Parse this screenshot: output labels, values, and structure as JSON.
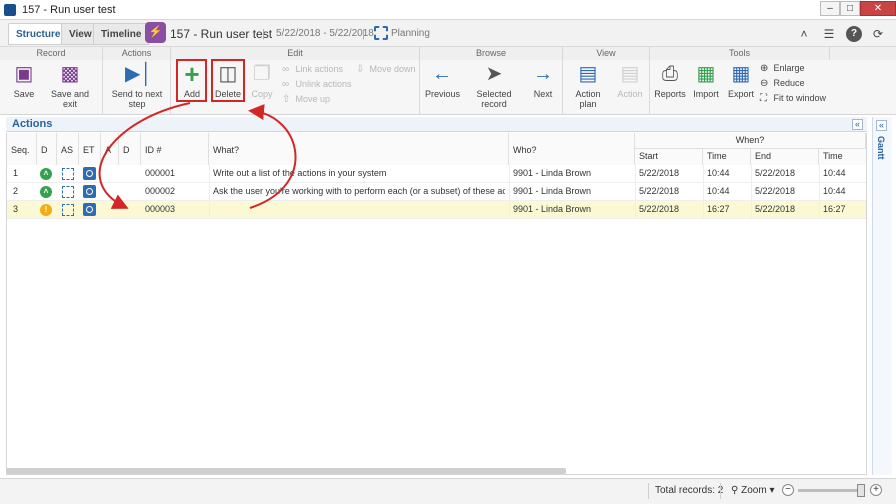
{
  "window": {
    "title": "157 - Run user test",
    "minimize": "–",
    "maximize": "□",
    "close": "✕"
  },
  "tabs": [
    {
      "label": "Structure"
    },
    {
      "label": "View"
    },
    {
      "label": "Timeline"
    }
  ],
  "record": {
    "badge": "⚡",
    "title": "157 - Run user test",
    "separator": "|",
    "dates": "5/22/2018 - 5/22/2018",
    "status": "Planning"
  },
  "topright": {
    "collapse": "˄",
    "list": "☰",
    "help": "?",
    "refresh": "⟳"
  },
  "ribbon": {
    "groups": {
      "record": "Record",
      "actions": "Actions",
      "edit": "Edit",
      "browse": "Browse",
      "view": "View",
      "tools": "Tools"
    },
    "save": "Save",
    "save_exit": "Save and exit",
    "send_next": "Send to next step",
    "add": "Add",
    "delete": "Delete",
    "copy": "Copy",
    "link_actions": "Link actions",
    "unlink_actions": "Unlink actions",
    "move_up": "Move up",
    "move_down": "Move down",
    "previous": "Previous",
    "selected_record": "Selected record",
    "next": "Next",
    "action_plan": "Action plan",
    "action": "Action",
    "reports": "Reports",
    "import": "Import",
    "export": "Export",
    "enlarge": "Enlarge",
    "reduce": "Reduce",
    "fit_window": "Fit to window"
  },
  "section": {
    "title": "Actions",
    "collapse": "«"
  },
  "grid": {
    "headers": {
      "seq": "Seq.",
      "d1": "D",
      "as": "AS",
      "et": "ET",
      "a": "A",
      "d2": "D",
      "id": "ID #",
      "what": "What?",
      "who": "Who?",
      "when": "When?",
      "start": "Start",
      "time1": "Time",
      "end": "End",
      "time2": "Time"
    },
    "rows": [
      {
        "seq": "1",
        "status": "˄",
        "id": "000001",
        "what": "Write out a list of the actions in your system",
        "who": "9901 - Linda Brown",
        "start": "5/22/2018",
        "start_time": "10:44",
        "end": "5/22/2018",
        "end_time": "10:44"
      },
      {
        "seq": "2",
        "status": "˄",
        "id": "000002",
        "what": "Ask the user you're working with to perform each (or a subset) of these actions",
        "who": "9901 - Linda Brown",
        "start": "5/22/2018",
        "start_time": "10:44",
        "end": "5/22/2018",
        "end_time": "10:44"
      },
      {
        "seq": "3",
        "status": "!",
        "id": "000003",
        "what": "",
        "who": "9901 - Linda Brown",
        "start": "5/22/2018",
        "start_time": "16:27",
        "end": "5/22/2018",
        "end_time": "16:27"
      }
    ]
  },
  "gantt": {
    "label": "Gantt",
    "collapse": "«"
  },
  "statusbar": {
    "total": "Total records: 2",
    "zoom": "Zoom",
    "minus": "−",
    "plus": "+"
  },
  "colors": {
    "accent": "#27629d",
    "highlight": "#d32727",
    "ok": "#35a04f",
    "warn": "#f0ad18",
    "badge": "#8a4ea3"
  }
}
